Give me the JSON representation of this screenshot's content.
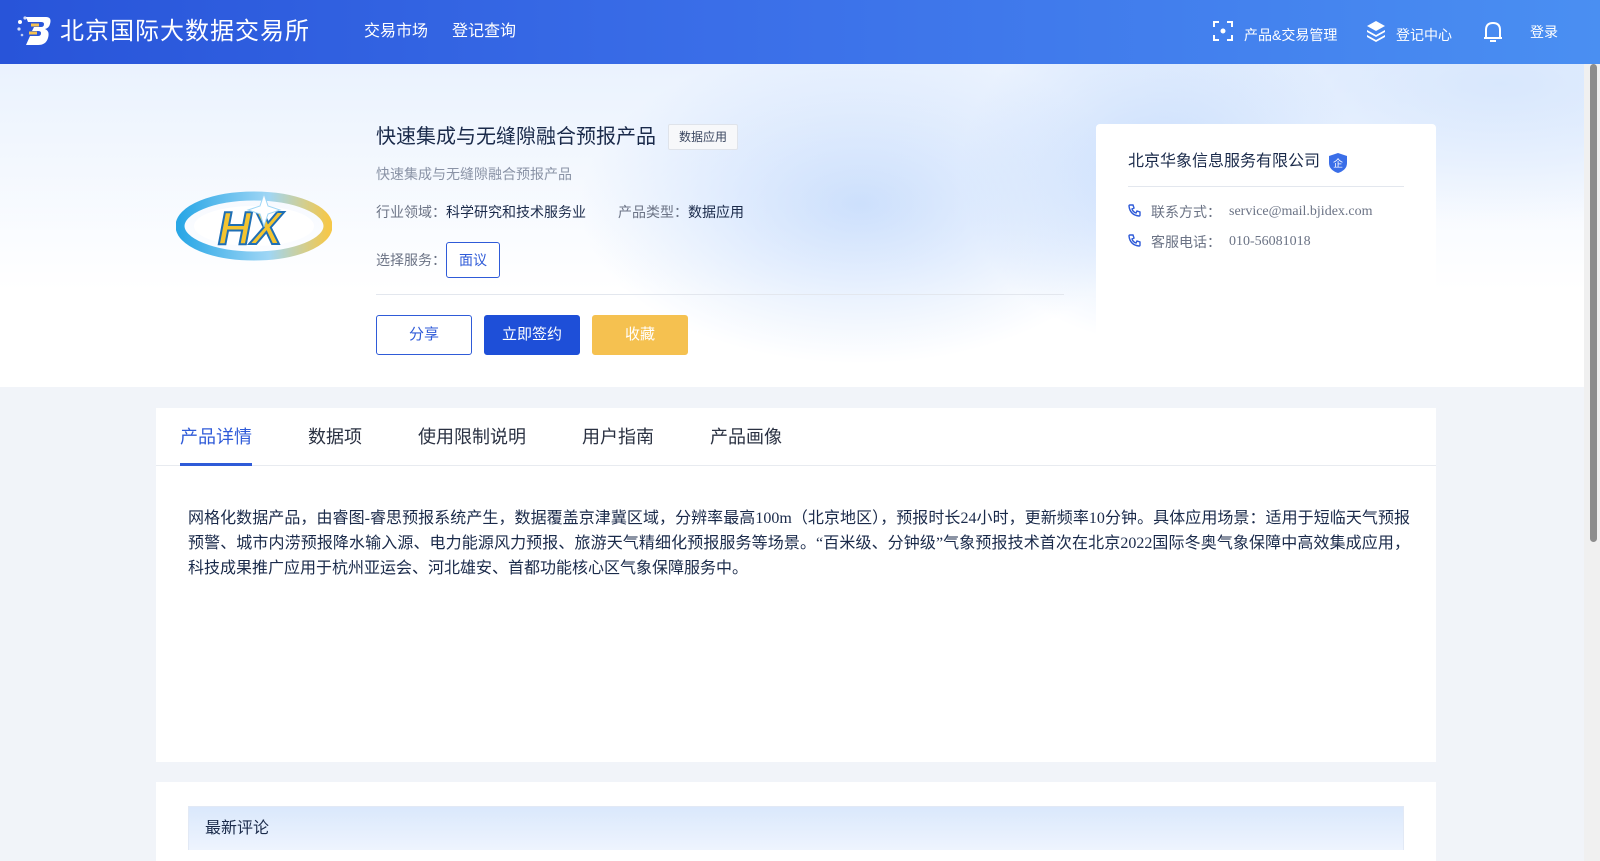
{
  "header": {
    "site_title": "北京国际大数据交易所",
    "nav": [
      "交易市场",
      "登记查询"
    ],
    "product_trade_mgmt": "产品&交易管理",
    "registry_center": "登记中心",
    "login": "登录",
    "icons": [
      "bjidex-logo-icon",
      "scan-icon",
      "layers-icon",
      "bell-icon"
    ],
    "accent": "#2854d9"
  },
  "product": {
    "title": "快速集成与无缝隙融合预报产品",
    "tag": "数据应用",
    "subtitle": "快速集成与无缝隙融合预报产品",
    "industry_label": "行业领域：",
    "industry_value": "科学研究和技术服务业",
    "type_label": "产品类型：",
    "type_value": "数据应用",
    "service_label": "选择服务：",
    "service_option": "面议",
    "logo_text": "HX",
    "buttons": {
      "share": "分享",
      "sign": "立即签约",
      "favorite": "收藏"
    }
  },
  "company": {
    "name": "北京华象信息服务有限公司",
    "badge": "企",
    "contact_label": "联系方式：",
    "contact_value": "service@mail.bjidex.com",
    "phone_label": "客服电话：",
    "phone_value": "010-56081018"
  },
  "tabs": [
    "产品详情",
    "数据项",
    "使用限制说明",
    "用户指南",
    "产品画像"
  ],
  "active_tab": "产品详情",
  "description": "网格化数据产品，由睿图-睿思预报系统产生，数据覆盖京津冀区域，分辨率最高100m（北京地区），预报时长24小时，更新频率10分钟。具体应用场景：适用于短临天气预报预警、城市内涝预报降水输入源、电力能源风力预报、旅游天气精细化预报服务等场景。“百米级、分钟级”气象预报技术首次在北京2022国际冬奥气象保障中高效集成应用，科技成果推广应用于杭州亚运会、河北雄安、首都功能核心区气象保障服务中。",
  "comments": {
    "title": "最新评论"
  }
}
